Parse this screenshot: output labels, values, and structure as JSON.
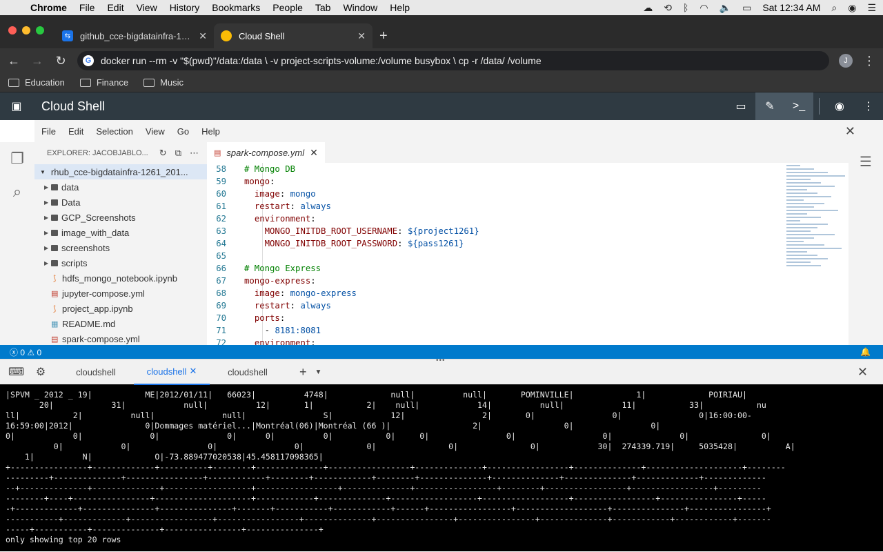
{
  "menubar": {
    "app": "Chrome",
    "items": [
      "File",
      "Edit",
      "View",
      "History",
      "Bookmarks",
      "People",
      "Tab",
      "Window",
      "Help"
    ],
    "clock": "Sat 12:34 AM"
  },
  "browser": {
    "tabs": [
      {
        "title": "github_cce-bigdatainfra-1261_20",
        "active": false
      },
      {
        "title": "Cloud Shell",
        "active": true
      }
    ],
    "address": "docker run --rm -v \"$(pwd)\"/data:/data \\ -v project-scripts-volume:/volume busybox \\ cp -r /data/ /volume",
    "profile_initial": "J",
    "bookmarks": [
      "Education",
      "Finance",
      "Music"
    ]
  },
  "cloudshell": {
    "title": "Cloud Shell"
  },
  "ide": {
    "menu": [
      "File",
      "Edit",
      "Selection",
      "View",
      "Go",
      "Help"
    ],
    "explorer_title": "EXPLORER: JACOBJABLO...",
    "root": "rhub_cce-bigdatainfra-1261_201...",
    "folders": [
      "data",
      "Data",
      "GCP_Screenshots",
      "image_with_data",
      "screenshots",
      "scripts"
    ],
    "files": [
      "hdfs_mongo_notebook.ipynb",
      "jupyter-compose.yml",
      "project_app.ipynb",
      "README.md",
      "spark-compose.yml"
    ],
    "editor_tab": "spark-compose.yml",
    "code": [
      {
        "n": "58",
        "indent": "",
        "key": "",
        "val": "",
        "comment": "# Mongo DB"
      },
      {
        "n": "59",
        "indent": "",
        "key": "mongo",
        "val": "",
        "comment": ""
      },
      {
        "n": "60",
        "indent": "  ",
        "key": "image",
        "val": "mongo",
        "comment": ""
      },
      {
        "n": "61",
        "indent": "  ",
        "key": "restart",
        "val": "always",
        "comment": ""
      },
      {
        "n": "62",
        "indent": "  ",
        "key": "environment",
        "val": "",
        "comment": ""
      },
      {
        "n": "63",
        "indent": "    ",
        "key": "MONGO_INITDB_ROOT_USERNAME",
        "val": "${project1261}",
        "comment": ""
      },
      {
        "n": "64",
        "indent": "    ",
        "key": "MONGO_INITDB_ROOT_PASSWORD",
        "val": "${pass1261}",
        "comment": ""
      },
      {
        "n": "65",
        "indent": "",
        "key": "",
        "val": "",
        "comment": ""
      },
      {
        "n": "66",
        "indent": "",
        "key": "",
        "val": "",
        "comment": "# Mongo Express"
      },
      {
        "n": "67",
        "indent": "",
        "key": "mongo-express",
        "val": "",
        "comment": ""
      },
      {
        "n": "68",
        "indent": "  ",
        "key": "image",
        "val": "mongo-express",
        "comment": ""
      },
      {
        "n": "69",
        "indent": "  ",
        "key": "restart",
        "val": "always",
        "comment": ""
      },
      {
        "n": "70",
        "indent": "  ",
        "key": "ports",
        "val": "",
        "comment": ""
      },
      {
        "n": "71",
        "indent": "    ",
        "key": "- ",
        "val": "8181:8081",
        "comment": "",
        "list": true
      },
      {
        "n": "72",
        "indent": "  ",
        "key": "environment",
        "val": "",
        "comment": ""
      }
    ],
    "status_errors": "0",
    "status_warnings": "0"
  },
  "terminal": {
    "tabs": [
      "cloudshell",
      "cloudshell",
      "cloudshell"
    ],
    "active_tab": 1,
    "lines": [
      "|SPVM _ 2012 _ 19|           ME|2012/01/11|   66023|          4748|             null|          null|       POMINVILLE|             1|             POIRIAU|",
      "       20|            31|            null|          12|       1|           2|    null|            14|          null|            11|           33|           nu",
      "ll|           2|          null|              null|                S|            12|                2|       0|                0|                0|16:00:00-",
      "16:59:00|2012|               0|Dommages matériel...|Montréal(06)|Montréal (66 )|                 2|                 0|                0|",
      "0|            0|              0|              0|      0|          0|           0|     0|                0|                  0|              0|               0|",
      "          0|            0|                0|                0|             0|               0|               0|            30|  274339.719|     5035428|          A|",
      "    1|          N|             O|-73.889477020538|45.458117098365|",
      "+----------------+-------------+----------+--------+--------------+-----------------+--------------+-----------------+--------------+--------------------+--------",
      "---------+--------------+----------------+------------+--------+------------+--------+--------------+--------------+--------------+-------------+-------------",
      "--+--------------+--------------+------------------+-----------------+--------------+-----------------+--------+-----------------+-----------------+---------",
      "--------+----+----------------+--------------------+------------+--------------+------------------+------------------+-----------------+----------------+-----",
      "-+-------------+---------------+---------------+-------+-----------+------------+------+-----------------+-------------------+---------------+----------------+",
      "-----------+-------------+-----------------+-----------------+--------------+----------------+----------------+--------------+------------+------------+-------",
      "-----+-----------+--------------+----------------+---------------+",
      "only showing top 20 rows"
    ]
  }
}
